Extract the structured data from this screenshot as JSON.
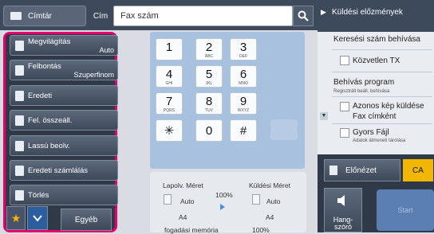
{
  "header": {
    "address_book_label": "Címtár",
    "address_label": "Cím",
    "fax_number_placeholder": "Fax szám",
    "search_icon": "search-icon"
  },
  "sidebar": {
    "items": [
      {
        "label": "Megvilágítás",
        "value": "Auto"
      },
      {
        "label": "Felbontás",
        "value": "Szuperfinom"
      },
      {
        "label": "Eredeti",
        "value": ""
      },
      {
        "label": "Fel. összeáll.",
        "value": ""
      },
      {
        "label": "Lassú beolv.",
        "value": ""
      },
      {
        "label": "Eredeti számlálás",
        "value": ""
      },
      {
        "label": "Törlés",
        "value": ""
      }
    ],
    "favorite_icon": "star-icon",
    "check_icon": "check-icon",
    "other_label": "Egyéb"
  },
  "keypad": {
    "keys": [
      {
        "d": "1",
        "s": ""
      },
      {
        "d": "2",
        "s": "ABC"
      },
      {
        "d": "3",
        "s": "DEF"
      },
      {
        "d": "4",
        "s": "GHI"
      },
      {
        "d": "5",
        "s": "JKL"
      },
      {
        "d": "6",
        "s": "MNO"
      },
      {
        "d": "7",
        "s": "PQRS"
      },
      {
        "d": "8",
        "s": "TUV"
      },
      {
        "d": "9",
        "s": "WXYZ"
      },
      {
        "d": "✳",
        "s": ""
      },
      {
        "d": "0",
        "s": ""
      },
      {
        "d": "#",
        "s": ""
      }
    ]
  },
  "status": {
    "scan_size_label": "Lapolv. Méret",
    "send_size_label": "Küldési Méret",
    "scan_mode": "Auto",
    "send_mode": "Auto",
    "ratio": "100%",
    "scan_paper": "A4",
    "send_paper": "A4",
    "memory_label": "fogadási memória",
    "memory_value": "100%"
  },
  "right_panel": {
    "history_label": "Küldési előzmények",
    "search_number_call": "Keresési szám behívása",
    "direct_tx": "Közvetlen TX",
    "call_program": "Behívás program",
    "call_program_sub": "Regisztrált beáll. behívása",
    "same_image_1": "Azonos kép küldése",
    "same_image_2": "Fax címként",
    "quick_file": "Gyors Fájl",
    "quick_file_sub": "Adatok átmeneti tárolása",
    "preview": "Előnézet",
    "ca": "CA",
    "speaker_1": "Hang-",
    "speaker_2": "szóró",
    "start": "Start"
  },
  "colors": {
    "highlight_border": "#e5006b",
    "ca_button": "#f2b705",
    "keypad_bg": "#a8c1de"
  }
}
